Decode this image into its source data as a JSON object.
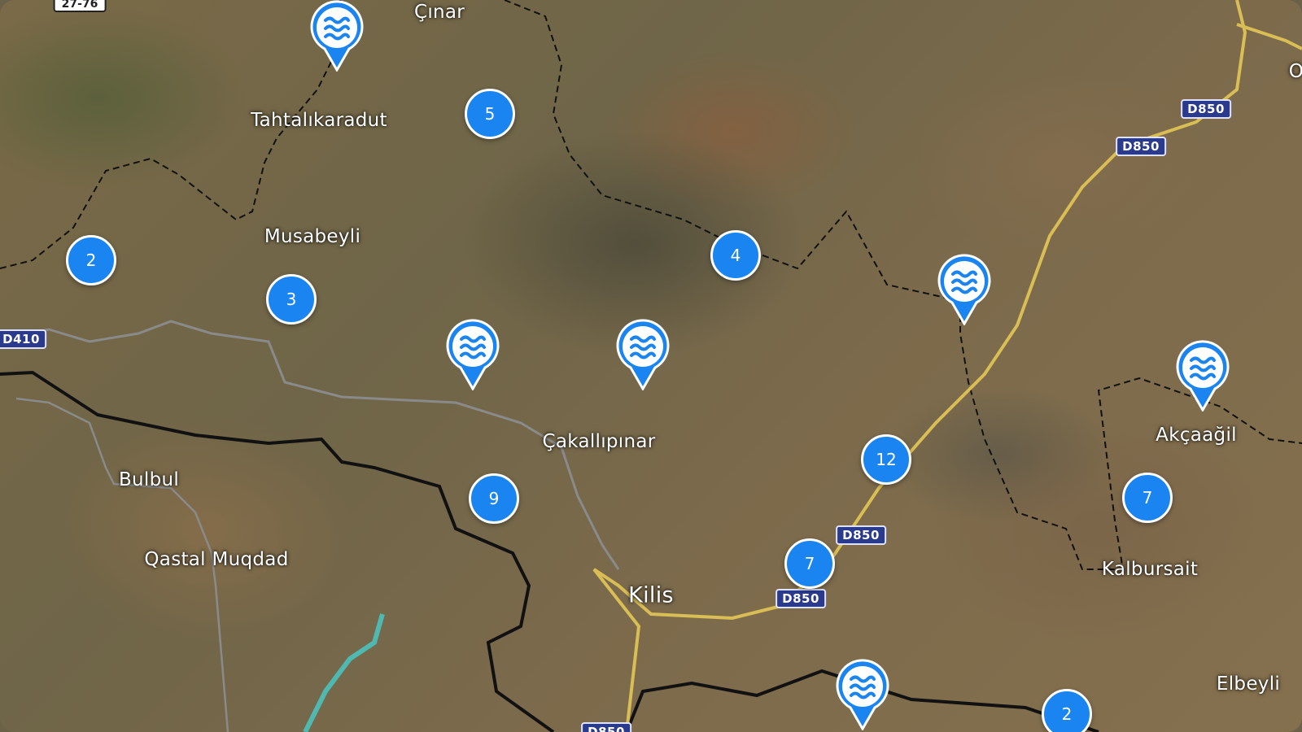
{
  "map": {
    "places": [
      "Çınar",
      "Tahtalıkaradut",
      "Musabeyli",
      "Çakallıpınar",
      "Bulbul",
      "Qastal Muqdad",
      "Kilis",
      "Akçaağil",
      "Kalbursait",
      "Elbeyli",
      "O"
    ],
    "clusters": [
      "5",
      "2",
      "3",
      "4",
      "12",
      "9",
      "7",
      "7",
      "2"
    ],
    "road_labels": {
      "d850_1": "D850",
      "d850_2": "D850",
      "d850_3": "D850",
      "d850_4": "D850",
      "d410": "D410",
      "top_left": "27-76",
      "bottom": "D850"
    },
    "pin_icon": "water-waves-icon",
    "colors": {
      "cluster": "#1a84f0",
      "pin": "#1a84f0",
      "shield": "#2a3a8c",
      "road": "#e0c060",
      "border": "#111111"
    }
  }
}
